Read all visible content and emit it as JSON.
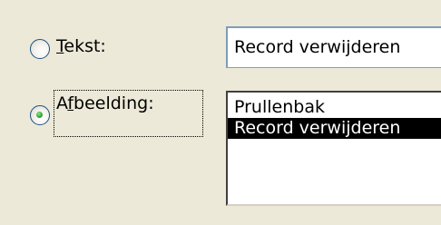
{
  "options": [
    {
      "label_prefix": "",
      "label_mnemonic": "T",
      "label_suffix": "ekst:",
      "selected": false
    },
    {
      "label_prefix": "A",
      "label_mnemonic": "f",
      "label_suffix": "beelding:",
      "selected": true
    }
  ],
  "text_field": {
    "value": "Record verwijderen"
  },
  "image_list": {
    "items": [
      "Prullenbak",
      "Record verwijderen"
    ],
    "selected_index": 1
  },
  "colors": {
    "background": "#ece9d8",
    "selection": "#000000",
    "radio_dot": "#2fa32f"
  }
}
